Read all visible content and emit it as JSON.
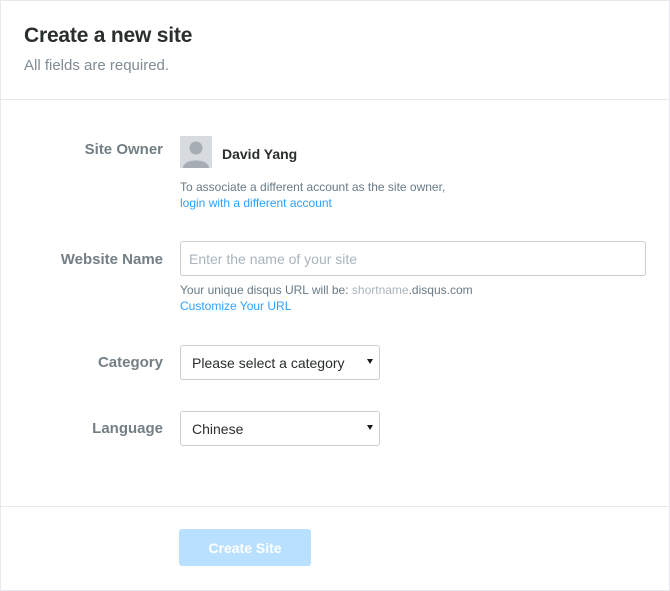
{
  "header": {
    "title": "Create a new site",
    "subtitle": "All fields are required."
  },
  "site_owner": {
    "label": "Site Owner",
    "name": "David Yang",
    "avatar_icon": "user-avatar-icon",
    "help_text": "To associate a different account as the site owner,",
    "link_text": "login with a different account"
  },
  "website_name": {
    "label": "Website Name",
    "placeholder": "Enter the name of your site",
    "value": "",
    "url_prefix": "Your unique disqus URL will be:",
    "url_shortname": "shortname",
    "url_domain": ".disqus.com",
    "customize_link": "Customize Your URL"
  },
  "category": {
    "label": "Category",
    "selected": "Please select a category"
  },
  "language": {
    "label": "Language",
    "selected": "Chinese"
  },
  "footer": {
    "create_button": "Create Site"
  },
  "colors": {
    "link": "#2e9fff",
    "button_disabled": "#b9e1ff",
    "label": "#737f85",
    "border": "#e7e9ee"
  }
}
